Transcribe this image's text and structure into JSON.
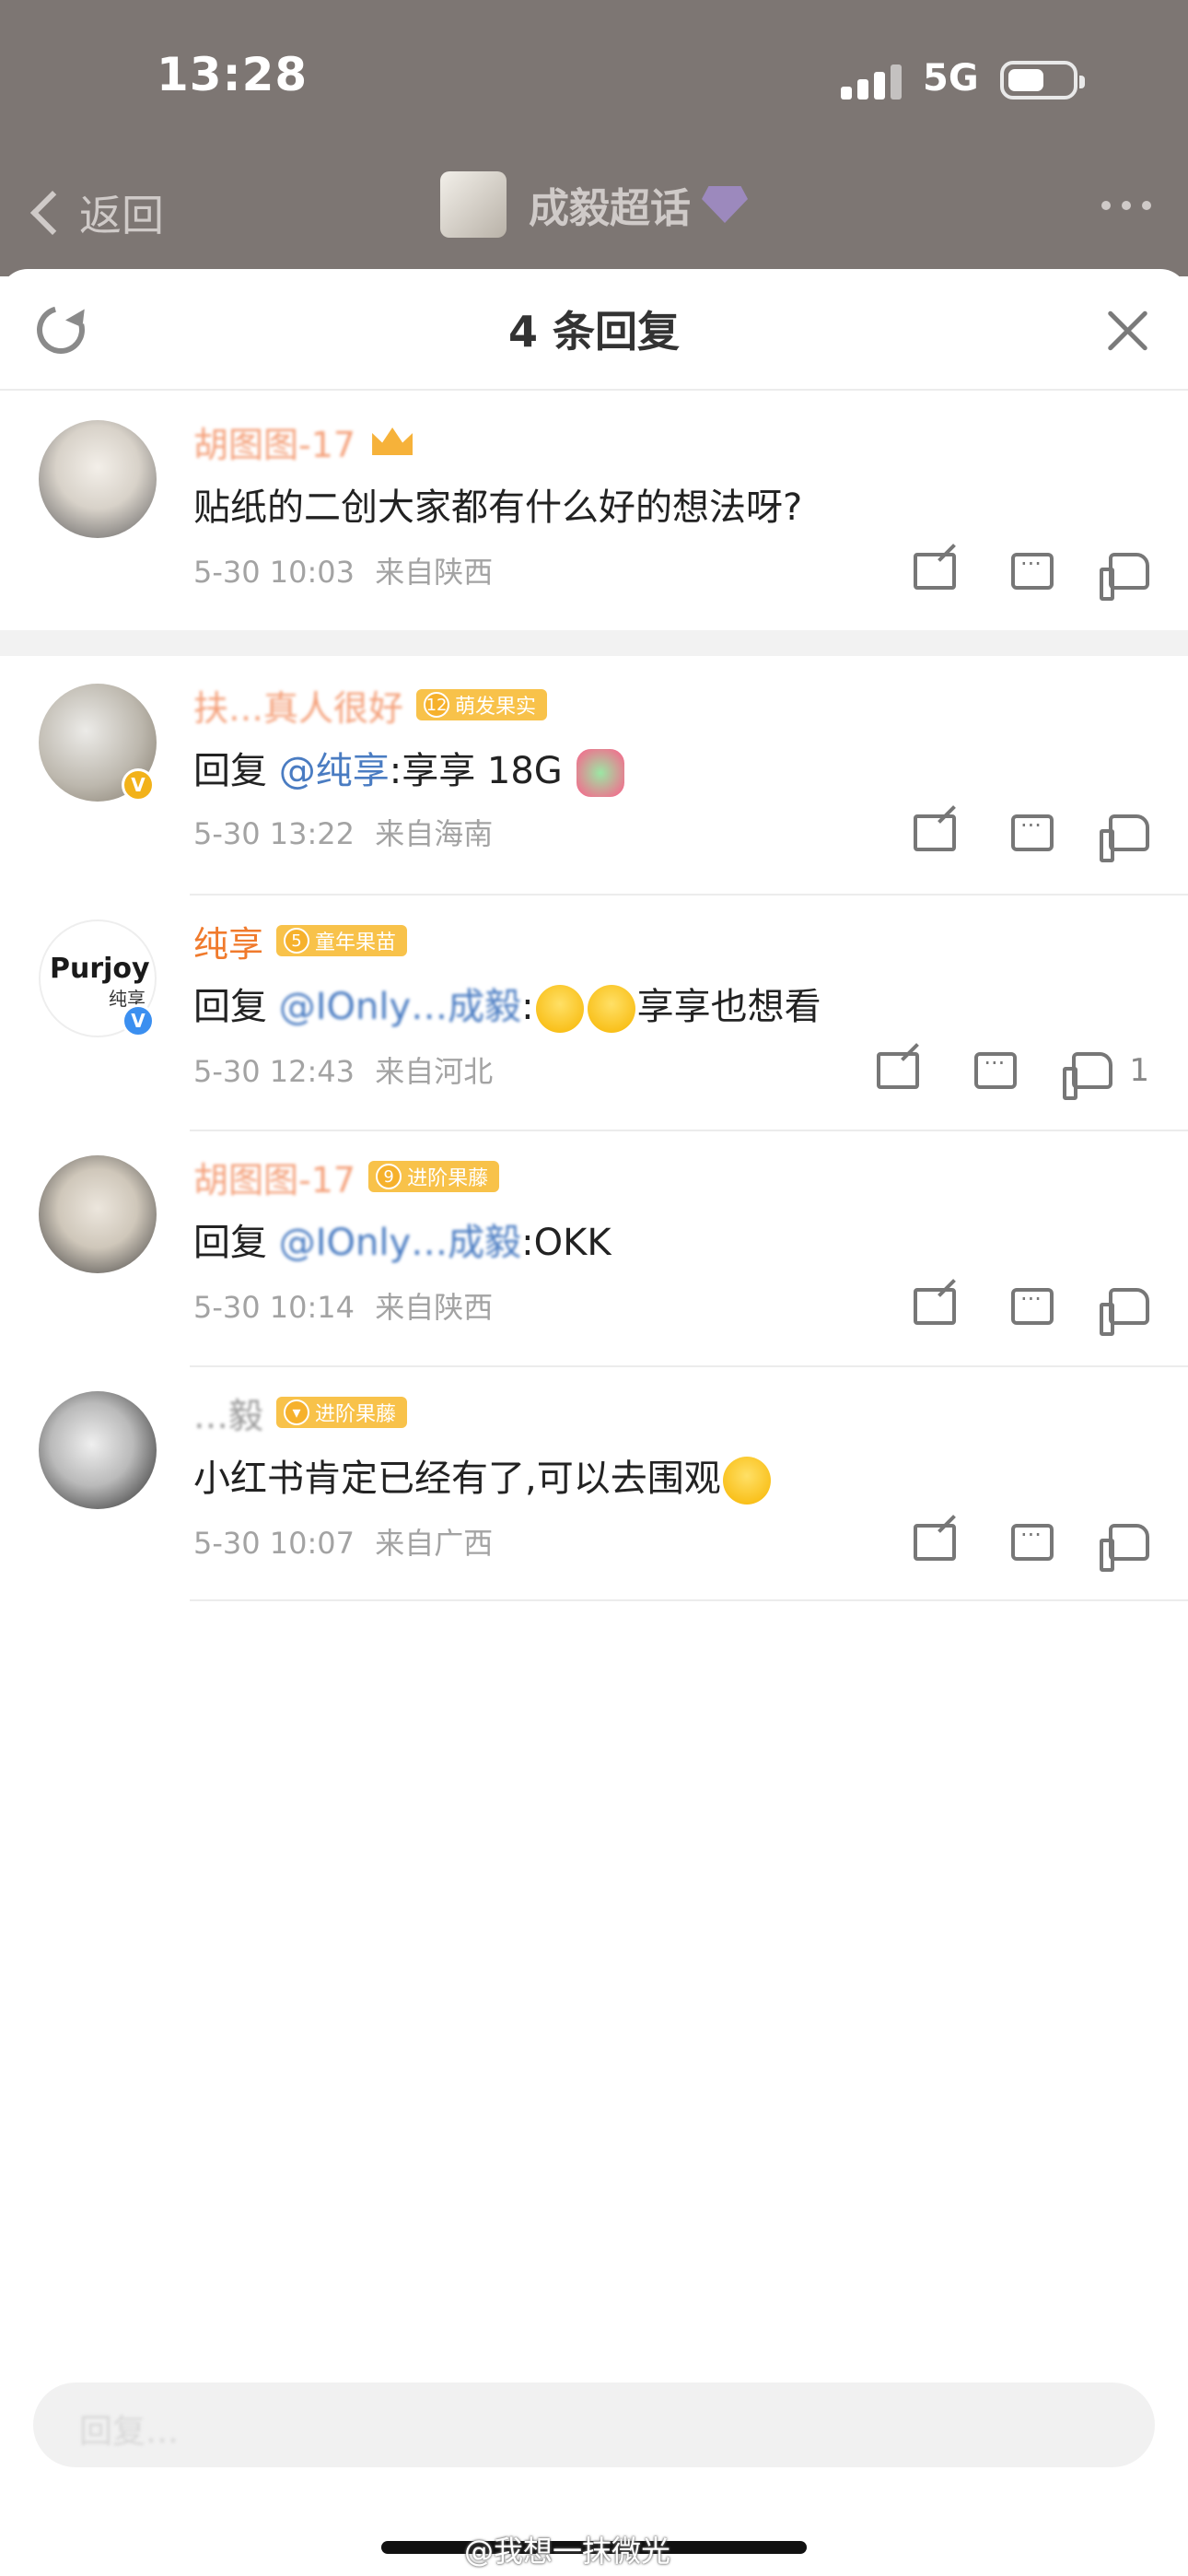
{
  "status_bar": {
    "time": "13:28",
    "network": "5G"
  },
  "nav": {
    "back_label": "返回",
    "title": "成毅超话"
  },
  "sheet": {
    "title": "4 条回复"
  },
  "comments": [
    {
      "username": "胡图图-17",
      "content": "贴纸的二创大家都有什么好的想法呀?",
      "date": "5-30 10:03",
      "location": "来自陕西"
    },
    {
      "username": "扶…真人很好",
      "tag_level": "12",
      "tag_label": "萌发果实",
      "reply_prefix": "回复 ",
      "mention": "@纯享",
      "content": ":享享 18G",
      "date": "5-30 13:22",
      "location": "来自海南"
    },
    {
      "username": "纯享",
      "tag_level": "5",
      "tag_label": "童年果苗",
      "avatar_text": "Purjoy",
      "avatar_subtext": "纯享",
      "reply_prefix": "回复 ",
      "mention": "@IOnly…成毅",
      "content_tail": "享享也想看",
      "date": "5-30 12:43",
      "location": "来自河北",
      "likes": "1"
    },
    {
      "username": "胡图图-17",
      "tag_level": "9",
      "tag_label": "进阶果藤",
      "reply_prefix": "回复 ",
      "mention": "@IOnly…成毅",
      "content": ":OKK",
      "date": "5-30 10:14",
      "location": "来自陕西"
    },
    {
      "username": "…毅",
      "tag_level": "",
      "tag_label": "进阶果藤",
      "content": "小红书肯定已经有了,可以去围观",
      "date": "5-30 10:07",
      "location": "来自广西"
    }
  ],
  "input": {
    "placeholder": "回复…"
  },
  "watermark": "@我想一抹微光",
  "colors": {
    "accent_orange": "#f07a2c",
    "mention_blue": "#4a7cc2",
    "tag_gold": "#f8c24a"
  }
}
